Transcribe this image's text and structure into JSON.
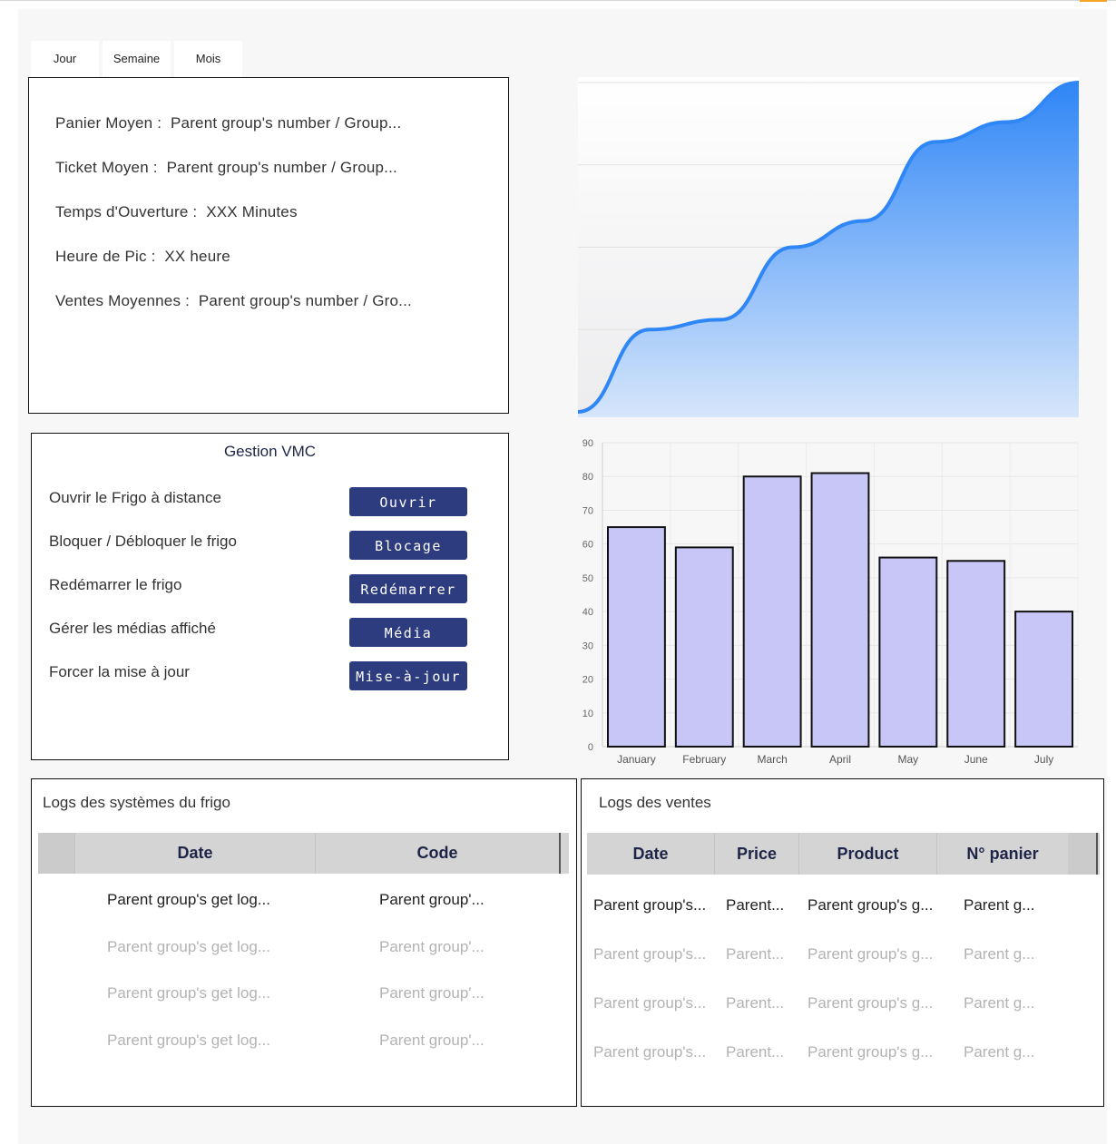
{
  "tabs": [
    "Jour",
    "Semaine",
    "Mois"
  ],
  "kpis": [
    {
      "label": "Panier Moyen :",
      "value": "Parent group's number / Group..."
    },
    {
      "label": "Ticket Moyen :",
      "value": "Parent group's number / Group..."
    },
    {
      "label": "Temps d'Ouverture :",
      "value": "XXX Minutes"
    },
    {
      "label": "Heure de Pic :",
      "value": "XX heure"
    },
    {
      "label": "Ventes Moyennes :",
      "value": "Parent group's number / Gro..."
    }
  ],
  "vmc": {
    "title": "Gestion VMC",
    "actions": [
      {
        "label": "Ouvrir le Frigo à distance",
        "button": "Ouvrir"
      },
      {
        "label": "Bloquer / Débloquer le frigo",
        "button": "Blocage"
      },
      {
        "label": "Redémarrer le frigo",
        "button": "Redémarrer"
      },
      {
        "label": "Gérer les médias affiché",
        "button": "Média"
      },
      {
        "label": "Forcer la mise à jour",
        "button": "Mise-à-jour"
      }
    ]
  },
  "system_logs": {
    "title": "Logs des systèmes du frigo",
    "columns": [
      "Date",
      "Code"
    ],
    "rows": [
      [
        "Parent group's get log...",
        "Parent group'..."
      ],
      [
        "Parent group's get log...",
        "Parent group'..."
      ],
      [
        "Parent group's get log...",
        "Parent group'..."
      ],
      [
        "Parent group's get log...",
        "Parent group'..."
      ]
    ]
  },
  "sales_logs": {
    "title": "Logs des ventes",
    "columns": [
      "Date",
      "Price",
      "Product",
      "N° panier"
    ],
    "rows": [
      [
        "Parent group's...",
        "Parent...",
        "Parent group's g...",
        "Parent g..."
      ],
      [
        "Parent group's...",
        "Parent...",
        "Parent group's g...",
        "Parent g..."
      ],
      [
        "Parent group's...",
        "Parent...",
        "Parent group's g...",
        "Parent g..."
      ],
      [
        "Parent group's...",
        "Parent...",
        "Parent group's g...",
        "Parent g..."
      ]
    ]
  },
  "colors": {
    "button": "#2c3c7e",
    "area_line": "#2f86f6",
    "bar_fill": "#c7c6f7",
    "bar_stroke": "#111111",
    "table_header": "#d4d4d4"
  },
  "chart_data": [
    {
      "type": "area",
      "x": [
        0,
        1,
        2,
        3,
        4,
        5,
        6,
        7
      ],
      "values": [
        0,
        25,
        28,
        50,
        58,
        82,
        88,
        100
      ],
      "ylim": [
        0,
        100
      ],
      "grid": true
    },
    {
      "type": "bar",
      "categories": [
        "January",
        "February",
        "March",
        "April",
        "May",
        "June",
        "July"
      ],
      "values": [
        65,
        59,
        80,
        81,
        56,
        55,
        40
      ],
      "ylim": [
        0,
        90
      ],
      "yticks": [
        0,
        10,
        20,
        30,
        40,
        50,
        60,
        70,
        80,
        90
      ],
      "grid": true
    }
  ]
}
